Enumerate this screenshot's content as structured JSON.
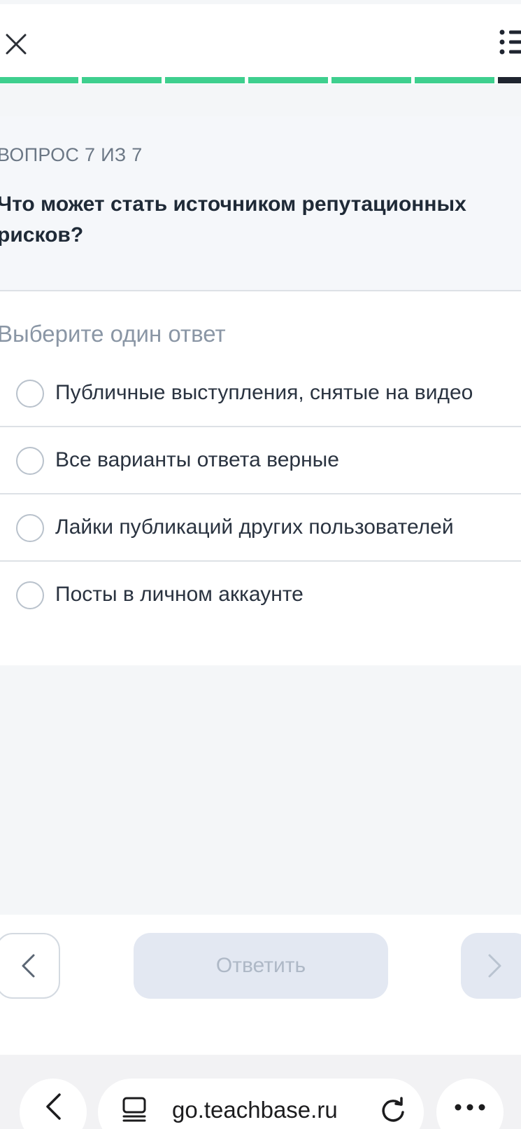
{
  "header": {
    "close_icon": "close-icon",
    "menu_icon": "list-icon",
    "progress": {
      "total_steps": 7,
      "current_step": 7,
      "completed_color": "#3ecf8e",
      "current_color": "#1f2530"
    }
  },
  "question": {
    "counter": "ВОПРОС 7 ИЗ 7",
    "text": "Что может стать источником репутационных рисков?"
  },
  "answers": {
    "title": "Выберите один ответ",
    "options": [
      {
        "label": "Публичные выступления, снятые на видео",
        "selected": false
      },
      {
        "label": "Все варианты ответа верные",
        "selected": false
      },
      {
        "label": "Лайки публикаций других пользователей",
        "selected": false
      },
      {
        "label": "Посты в личном аккаунте",
        "selected": false
      }
    ]
  },
  "footer": {
    "prev_icon": "chevron-left-icon",
    "submit_label": "Ответить",
    "next_icon": "chevron-right-icon"
  },
  "browser": {
    "url": "go.teachbase.ru",
    "back_icon": "chevron-left-icon",
    "tabs_icon": "reader-icon",
    "reload_icon": "reload-icon",
    "more_icon": "more-icon"
  }
}
